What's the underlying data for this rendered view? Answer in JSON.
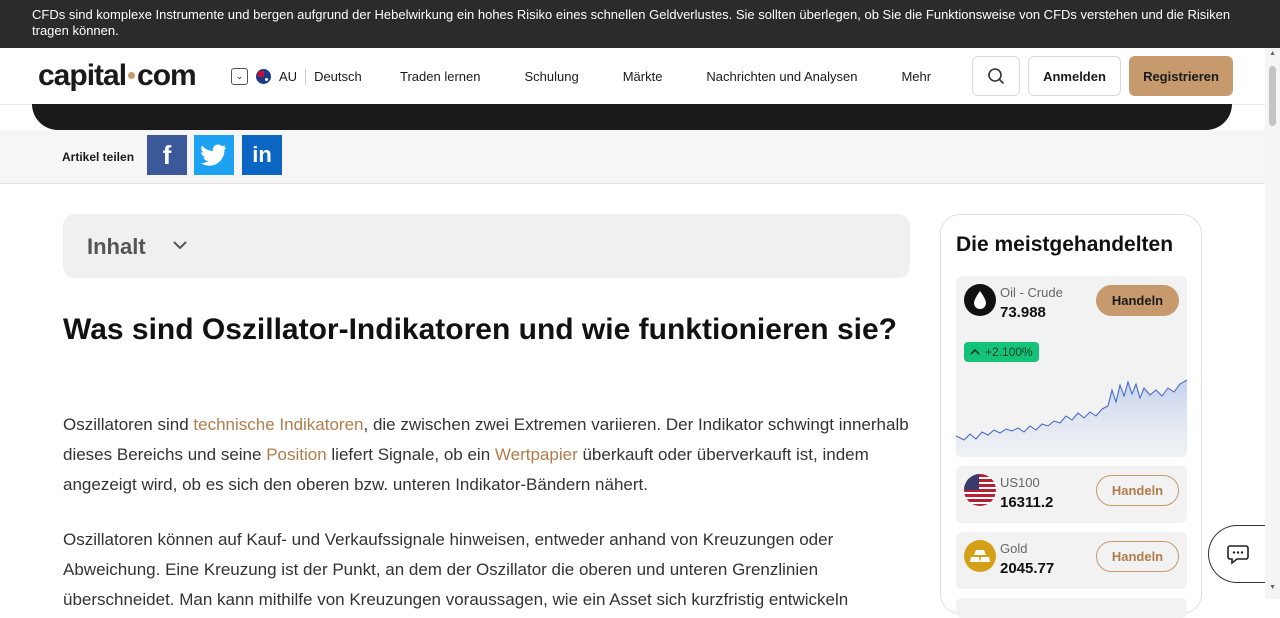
{
  "risk_warning": "CFDs sind komplexe Instrumente und bergen aufgrund der Hebelwirkung ein hohes Risiko eines schnellen Geldverlustes. Sie sollten überlegen, ob Sie die Funktionsweise von CFDs verstehen und die Risiken tragen können.",
  "header": {
    "logo": {
      "left": "capital",
      "right": "com"
    },
    "region": {
      "code": "AU",
      "language": "Deutsch"
    },
    "nav": [
      "Traden lernen",
      "Schulung",
      "Märkte",
      "Nachrichten und Analysen",
      "Mehr"
    ],
    "login_label": "Anmelden",
    "register_label": "Registrieren"
  },
  "share": {
    "label": "Artikel teilen",
    "facebook_glyph": "f",
    "linkedin_glyph": "in"
  },
  "toc": {
    "label": "Inhalt"
  },
  "article": {
    "title": "Was sind Oszillator-Indikatoren und wie funktionieren sie?",
    "p1": {
      "t1": "Oszillatoren sind ",
      "link1": "technische Indikatoren",
      "t2": ", die zwischen zwei Extremen variieren. Der Indikator schwingt innerhalb dieses Bereichs und seine ",
      "link2": "Position",
      "t3": " liefert Signale, ob ein ",
      "link3": "Wertpapier",
      "t4": " überkauft oder überverkauft ist, indem angezeigt wird, ob es sich den oberen bzw. unteren Indikator-Bändern nähert."
    },
    "p2": "Oszillatoren können auf Kauf- und Verkaufssignale hinweisen, entweder anhand von Kreuzungen oder Abweichung. Eine Kreuzung ist der Punkt, an dem der Oszillator die oberen und unteren Grenzlinien überschneidet. Man kann mithilfe von Kreuzungen voraussagen, wie ein Asset sich kurzfristig entwickeln"
  },
  "widget": {
    "title": "Die meistgehandelten",
    "trade_label": "Handeln",
    "assets": [
      {
        "name": "Oil - Crude",
        "price": "73.988",
        "change": "+2.100%",
        "icon": "oil-drop-icon"
      },
      {
        "name": "US100",
        "price": "16311.2",
        "icon": "us-flag-icon"
      },
      {
        "name": "Gold",
        "price": "2045.77",
        "icon": "gold-bars-icon"
      }
    ]
  },
  "colors": {
    "accent": "#c69a6d",
    "link": "#b07d4c",
    "positive": "#14c27a",
    "dark": "#1a1a1a"
  }
}
